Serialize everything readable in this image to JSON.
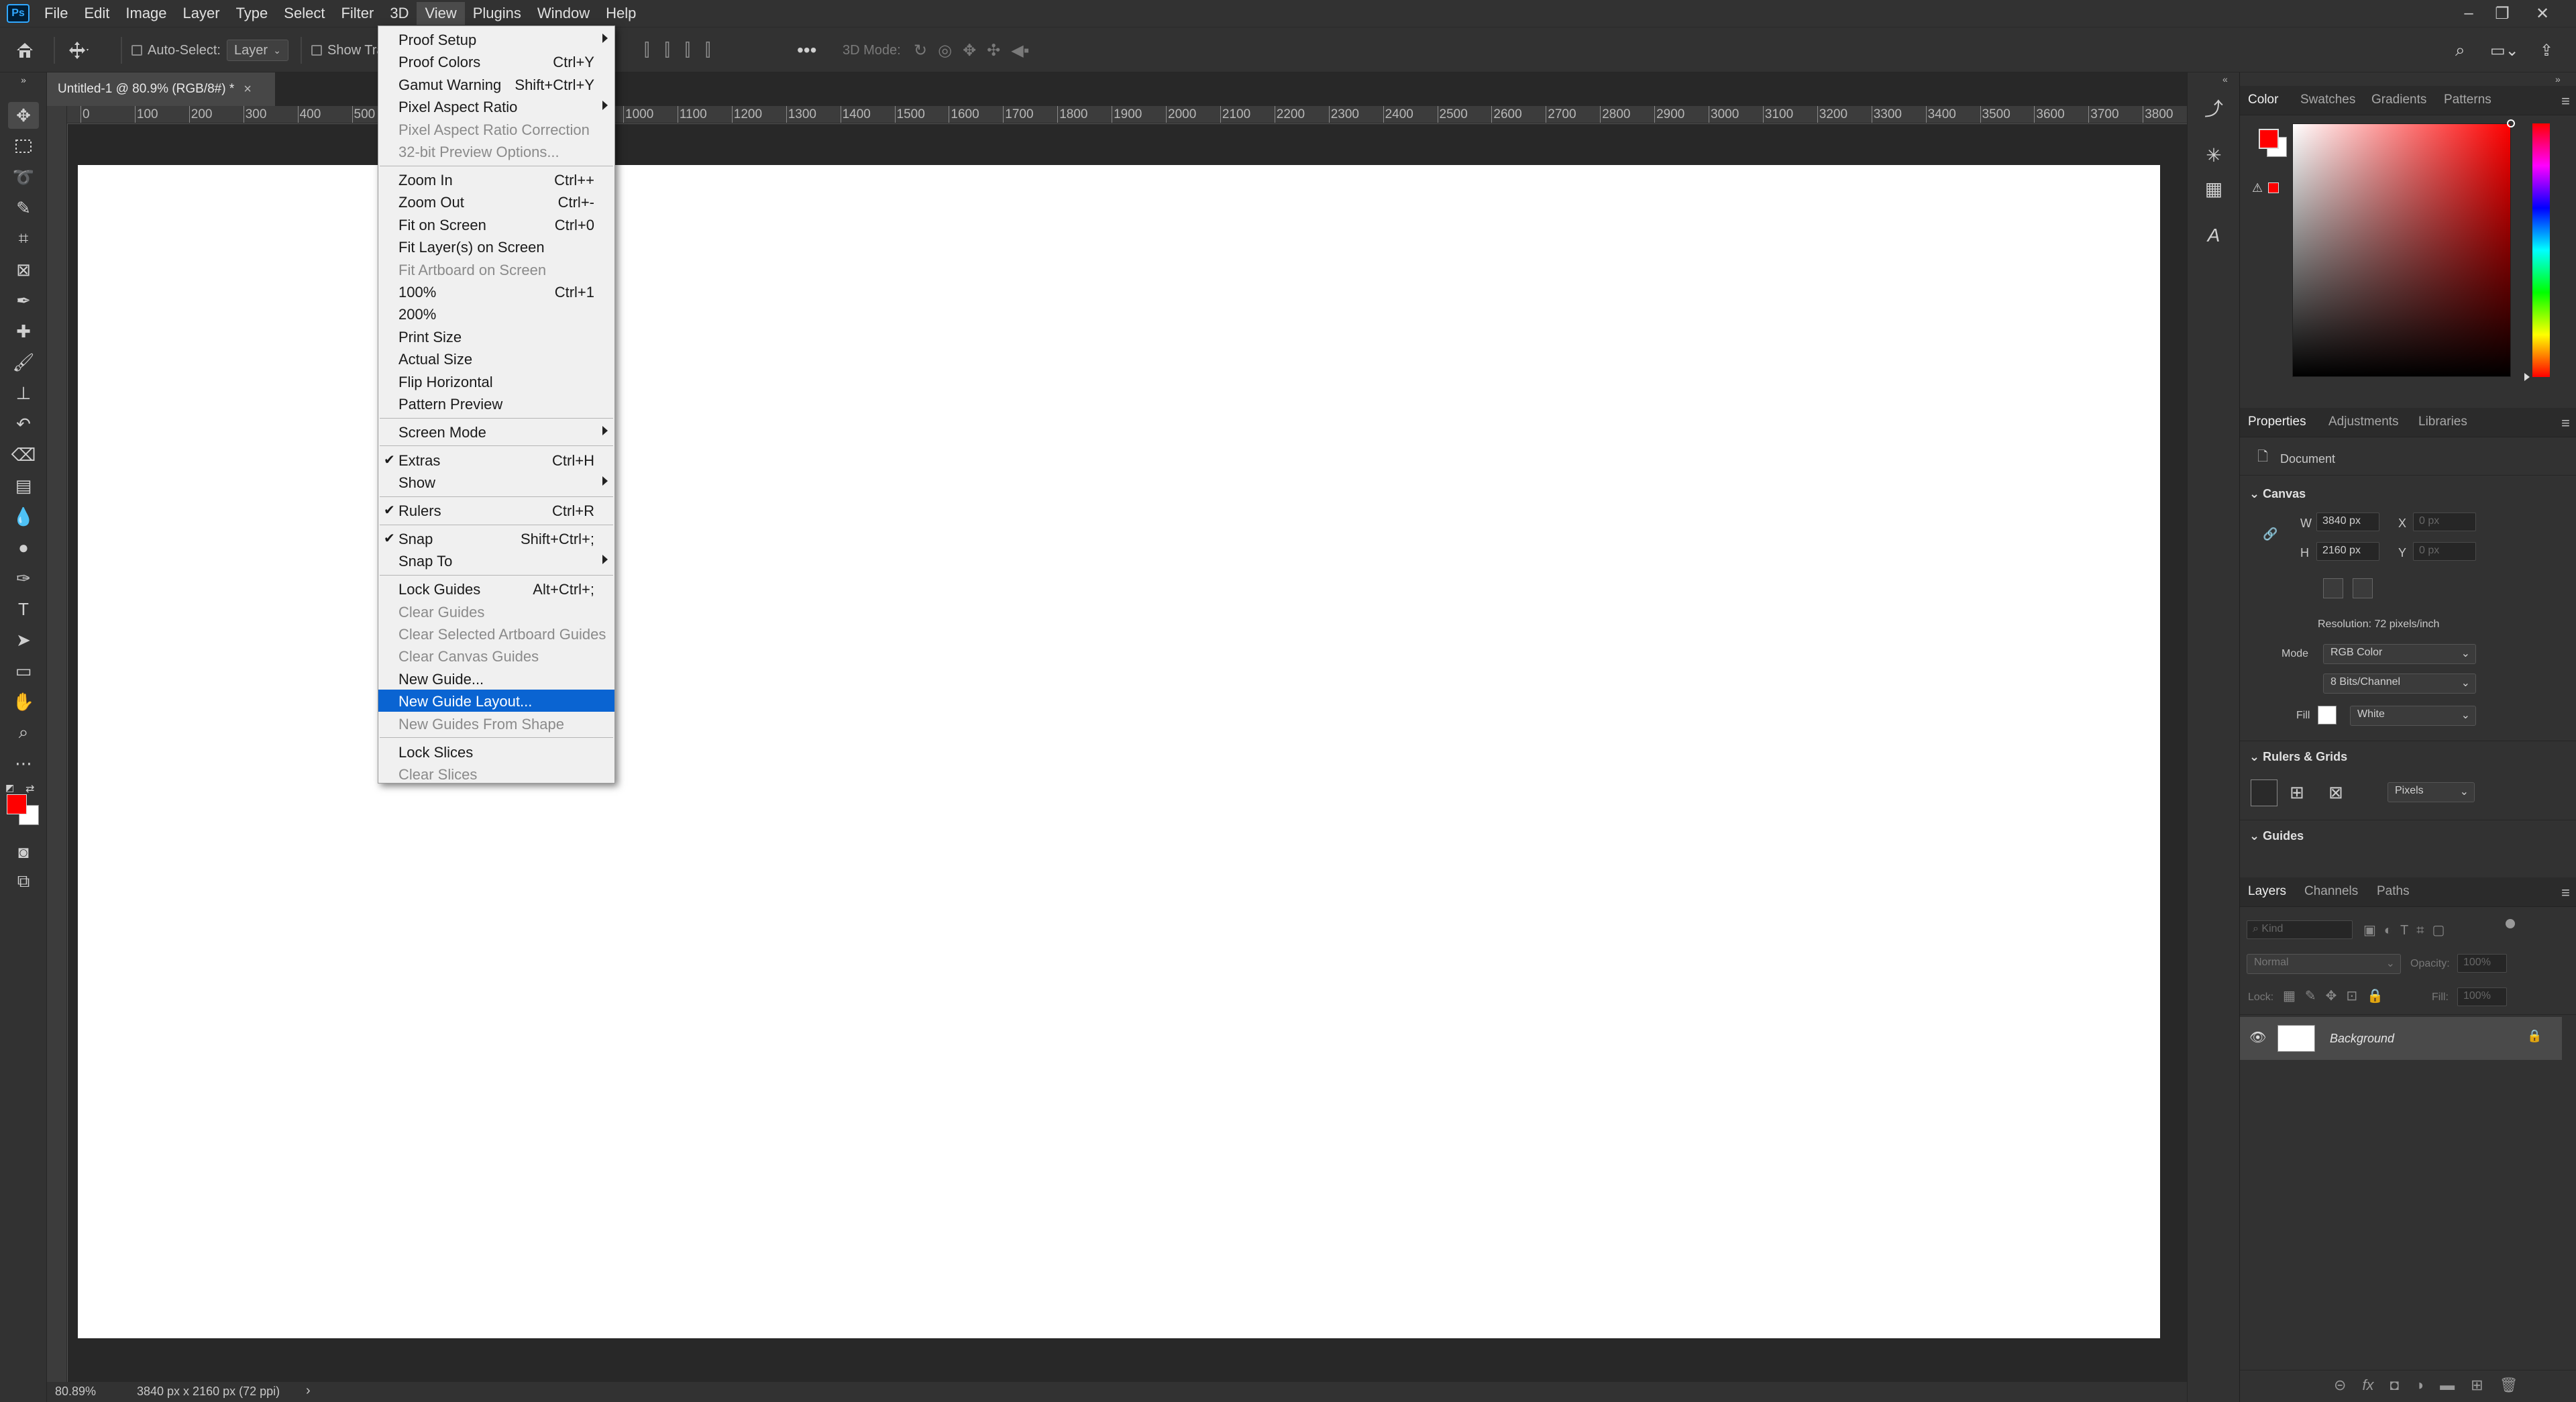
{
  "app": {
    "logo": "Ps"
  },
  "menubar": {
    "items": [
      "File",
      "Edit",
      "Image",
      "Layer",
      "Type",
      "Select",
      "Filter",
      "3D",
      "View",
      "Plugins",
      "Window",
      "Help"
    ],
    "active": "View",
    "window_controls": {
      "minimize": "–",
      "restore": "❐",
      "close": "✕"
    }
  },
  "options": {
    "auto_select_label": "Auto-Select:",
    "auto_select_value": "Layer",
    "show_transform": "Show Tra",
    "mode_3d": "3D Mode:"
  },
  "document": {
    "tab_title": "Untitled-1 @ 80.9% (RGB/8#) *",
    "tab_close": "×",
    "zoom": "80.89%",
    "size_info": "3840 px x 2160 px (72 ppi)",
    "status_arrow": "›"
  },
  "ruler": {
    "h_labels": [
      "0",
      "100",
      "200",
      "300",
      "400",
      "500",
      "1000",
      "1100",
      "1200",
      "1300",
      "1400",
      "1500",
      "1600",
      "1700",
      "1800",
      "1900",
      "2000",
      "2100",
      "2200",
      "2300",
      "2400",
      "2500",
      "2600",
      "2700",
      "2800",
      "2900",
      "3000",
      "3100",
      "3200",
      "3300",
      "3400",
      "3500",
      "3600",
      "3700",
      "3800"
    ]
  },
  "view_menu": {
    "items": [
      {
        "label": "Proof Setup",
        "shortcut": "",
        "submenu": true,
        "disabled": false,
        "checked": false
      },
      {
        "label": "Proof Colors",
        "shortcut": "Ctrl+Y",
        "submenu": false,
        "disabled": false,
        "checked": false
      },
      {
        "label": "Gamut Warning",
        "shortcut": "Shift+Ctrl+Y",
        "submenu": false,
        "disabled": false,
        "checked": false
      },
      {
        "label": "Pixel Aspect Ratio",
        "shortcut": "",
        "submenu": true,
        "disabled": false,
        "checked": false
      },
      {
        "label": "Pixel Aspect Ratio Correction",
        "shortcut": "",
        "submenu": false,
        "disabled": true,
        "checked": false
      },
      {
        "label": "32-bit Preview Options...",
        "shortcut": "",
        "submenu": false,
        "disabled": true,
        "checked": false
      },
      {
        "sep": true
      },
      {
        "label": "Zoom In",
        "shortcut": "Ctrl++",
        "submenu": false,
        "disabled": false,
        "checked": false
      },
      {
        "label": "Zoom Out",
        "shortcut": "Ctrl+-",
        "submenu": false,
        "disabled": false,
        "checked": false
      },
      {
        "label": "Fit on Screen",
        "shortcut": "Ctrl+0",
        "submenu": false,
        "disabled": false,
        "checked": false
      },
      {
        "label": "Fit Layer(s) on Screen",
        "shortcut": "",
        "submenu": false,
        "disabled": false,
        "checked": false
      },
      {
        "label": "Fit Artboard on Screen",
        "shortcut": "",
        "submenu": false,
        "disabled": true,
        "checked": false
      },
      {
        "label": "100%",
        "shortcut": "Ctrl+1",
        "submenu": false,
        "disabled": false,
        "checked": false
      },
      {
        "label": "200%",
        "shortcut": "",
        "submenu": false,
        "disabled": false,
        "checked": false
      },
      {
        "label": "Print Size",
        "shortcut": "",
        "submenu": false,
        "disabled": false,
        "checked": false
      },
      {
        "label": "Actual Size",
        "shortcut": "",
        "submenu": false,
        "disabled": false,
        "checked": false
      },
      {
        "label": "Flip Horizontal",
        "shortcut": "",
        "submenu": false,
        "disabled": false,
        "checked": false
      },
      {
        "label": "Pattern Preview",
        "shortcut": "",
        "submenu": false,
        "disabled": false,
        "checked": false
      },
      {
        "sep": true
      },
      {
        "label": "Screen Mode",
        "shortcut": "",
        "submenu": true,
        "disabled": false,
        "checked": false
      },
      {
        "sep": true
      },
      {
        "label": "Extras",
        "shortcut": "Ctrl+H",
        "submenu": false,
        "disabled": false,
        "checked": true
      },
      {
        "label": "Show",
        "shortcut": "",
        "submenu": true,
        "disabled": false,
        "checked": false
      },
      {
        "sep": true
      },
      {
        "label": "Rulers",
        "shortcut": "Ctrl+R",
        "submenu": false,
        "disabled": false,
        "checked": true
      },
      {
        "sep": true
      },
      {
        "label": "Snap",
        "shortcut": "Shift+Ctrl+;",
        "submenu": false,
        "disabled": false,
        "checked": true
      },
      {
        "label": "Snap To",
        "shortcut": "",
        "submenu": true,
        "disabled": false,
        "checked": false
      },
      {
        "sep": true
      },
      {
        "label": "Lock Guides",
        "shortcut": "Alt+Ctrl+;",
        "submenu": false,
        "disabled": false,
        "checked": false
      },
      {
        "label": "Clear Guides",
        "shortcut": "",
        "submenu": false,
        "disabled": true,
        "checked": false
      },
      {
        "label": "Clear Selected Artboard Guides",
        "shortcut": "",
        "submenu": false,
        "disabled": true,
        "checked": false
      },
      {
        "label": "Clear Canvas Guides",
        "shortcut": "",
        "submenu": false,
        "disabled": true,
        "checked": false
      },
      {
        "label": "New Guide...",
        "shortcut": "",
        "submenu": false,
        "disabled": false,
        "checked": false
      },
      {
        "label": "New Guide Layout...",
        "shortcut": "",
        "submenu": false,
        "disabled": false,
        "checked": false,
        "highlighted": true
      },
      {
        "label": "New Guides From Shape",
        "shortcut": "",
        "submenu": false,
        "disabled": true,
        "checked": false
      },
      {
        "sep": true
      },
      {
        "label": "Lock Slices",
        "shortcut": "",
        "submenu": false,
        "disabled": false,
        "checked": false
      },
      {
        "label": "Clear Slices",
        "shortcut": "",
        "submenu": false,
        "disabled": true,
        "checked": false
      }
    ]
  },
  "color_panel": {
    "tabs": [
      "Color",
      "Swatches",
      "Gradients",
      "Patterns"
    ],
    "active": "Color",
    "foreground": "#ff0000",
    "background": "#ffffff"
  },
  "properties_panel": {
    "tabs": [
      "Properties",
      "Adjustments",
      "Libraries"
    ],
    "active": "Properties",
    "doc_label": "Document",
    "canvas_section": "Canvas",
    "w_label": "W",
    "w_value": "3840 px",
    "h_label": "H",
    "h_value": "2160 px",
    "x_label": "X",
    "x_placeholder": "0 px",
    "y_label": "Y",
    "y_placeholder": "0 px",
    "resolution": "Resolution: 72 pixels/inch",
    "mode_label": "Mode",
    "mode_value": "RGB Color",
    "bits_value": "8 Bits/Channel",
    "fill_label": "Fill",
    "fill_value": "White",
    "rulers_section": "Rulers & Grids",
    "units_value": "Pixels",
    "guides_section": "Guides"
  },
  "layers_panel": {
    "tabs": [
      "Layers",
      "Channels",
      "Paths"
    ],
    "active": "Layers",
    "kind_placeholder": "Kind",
    "blend_mode": "Normal",
    "opacity_label": "Opacity:",
    "opacity_value": "100%",
    "lock_label": "Lock:",
    "fill_label": "Fill:",
    "fill_value": "100%",
    "layers": [
      {
        "name": "Background",
        "visible": true,
        "locked": true
      }
    ],
    "footer_icons": [
      "link-icon",
      "fx-icon",
      "mask-icon",
      "adjustment-icon",
      "group-icon",
      "new-layer-icon",
      "trash-icon"
    ]
  },
  "colors": {
    "menu_highlight": "#0a64d2",
    "accent_fg": "#ff0000"
  }
}
